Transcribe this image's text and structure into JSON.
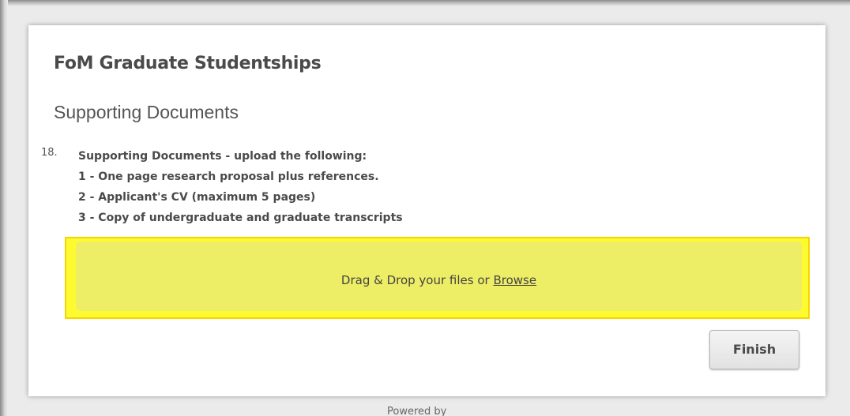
{
  "form": {
    "title": "FoM Graduate Studentships",
    "section_title": "Supporting Documents"
  },
  "question": {
    "number": "18.",
    "label": "Supporting Documents - upload the following:",
    "items": [
      "1 - One page research proposal plus references.",
      "2 - Applicant's CV (maximum 5 pages)",
      "3 - Copy of undergraduate and graduate transcripts"
    ]
  },
  "upload": {
    "prompt": "Drag & Drop your files or ",
    "browse_label": "Browse"
  },
  "actions": {
    "finish_label": "Finish"
  },
  "footer": {
    "powered_by": "Powered by"
  }
}
